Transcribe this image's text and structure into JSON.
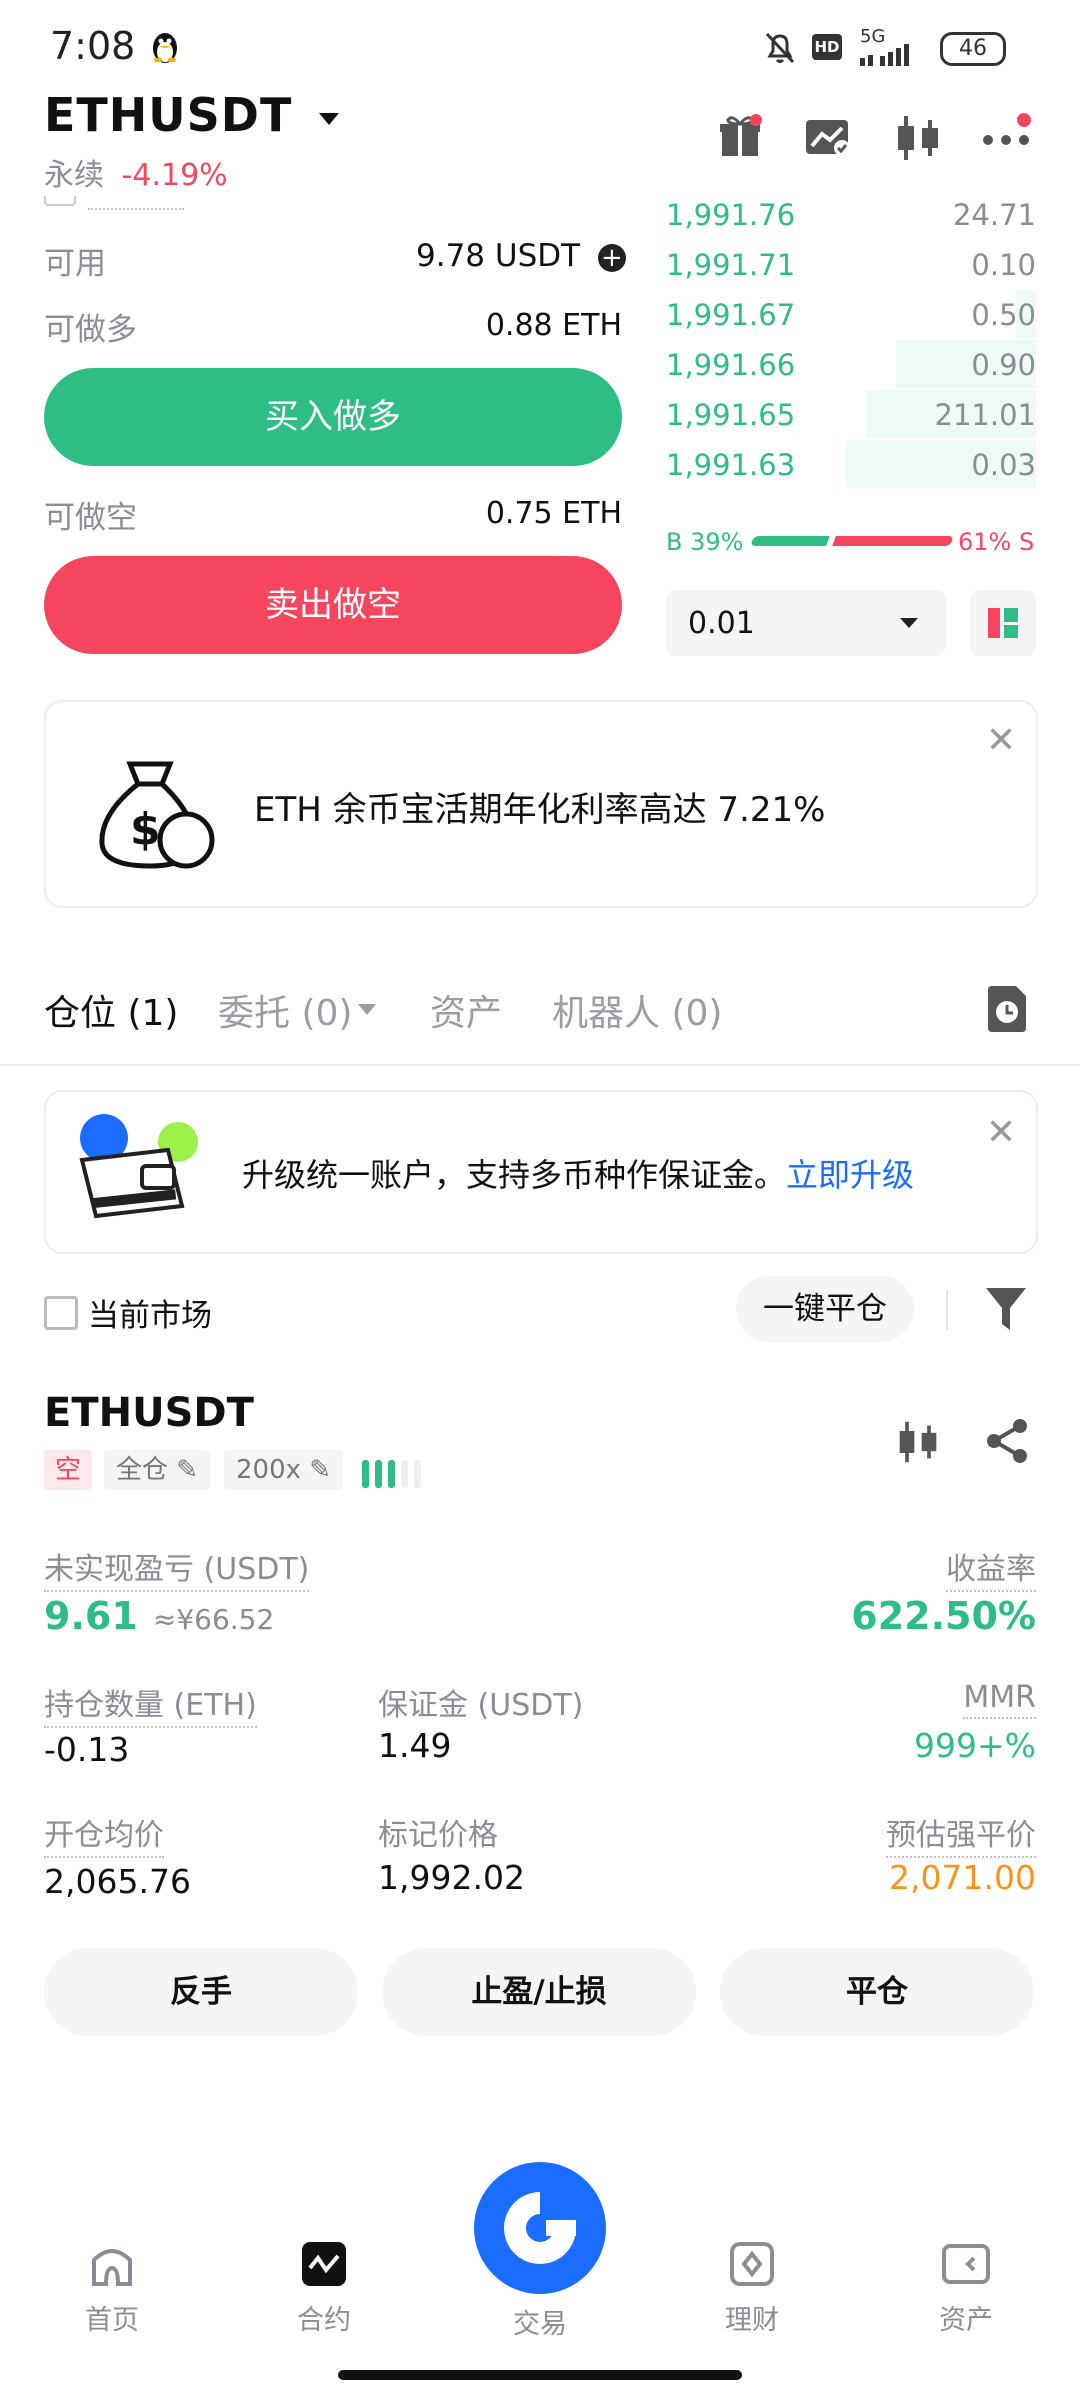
{
  "status": {
    "time": "7:08",
    "network": "5G",
    "battery": "46"
  },
  "header": {
    "pair": "ETHUSDT",
    "type": "永续",
    "change": "-4.19%"
  },
  "balance": {
    "available_label": "可用",
    "available_value": "9.78 USDT",
    "long_label": "可做多",
    "long_value": "0.88 ETH",
    "short_label": "可做空",
    "short_value": "0.75 ETH"
  },
  "buttons": {
    "long": "买入做多",
    "short": "卖出做空"
  },
  "orderbook": {
    "rows": [
      {
        "price": "1,991.76",
        "qty": "24.71"
      },
      {
        "price": "1,991.71",
        "qty": "0.10"
      },
      {
        "price": "1,991.67",
        "qty": "0.50"
      },
      {
        "price": "1,991.66",
        "qty": "0.90"
      },
      {
        "price": "1,991.65",
        "qty": "211.01"
      },
      {
        "price": "1,991.63",
        "qty": "0.03"
      }
    ],
    "buy_ratio_label": "B 39%",
    "sell_ratio_label": "61% S",
    "buy_ratio": 0.39,
    "precision": "0.01"
  },
  "promo": {
    "text": "ETH 余币宝活期年化利率高达 7.21%"
  },
  "tabs": [
    "仓位 (1)",
    "委托 (0)",
    "资产",
    "机器人 (0)"
  ],
  "upgrade": {
    "text": "升级统一账户，支持多币种作保证金。",
    "link": "立即升级"
  },
  "filter": {
    "current_market": "当前市场",
    "close_all": "一键平仓"
  },
  "position": {
    "symbol": "ETHUSDT",
    "side": "空",
    "margin_mode": "全仓",
    "leverage": "200x",
    "upnl_label": "未实现盈亏 (USDT)",
    "upnl": "9.61",
    "upnl_cny": "≈¥66.52",
    "roe_label": "收益率",
    "roe": "622.50%",
    "size_label": "持仓数量 (ETH)",
    "size": "-0.13",
    "margin_label": "保证金 (USDT)",
    "margin": "1.49",
    "mmr_label": "MMR",
    "mmr": "999+%",
    "entry_label": "开仓均价",
    "entry": "2,065.76",
    "mark_label": "标记价格",
    "mark": "1,992.02",
    "liq_label": "预估强平价",
    "liq": "2,071.00"
  },
  "actions": {
    "reverse": "反手",
    "tpsl": "止盈/止损",
    "close": "平仓"
  },
  "nav": [
    {
      "label": "首页",
      "icon": "home-icon"
    },
    {
      "label": "合约",
      "icon": "futures-icon"
    },
    {
      "label": "交易",
      "icon": "trade-icon"
    },
    {
      "label": "理财",
      "icon": "earn-icon"
    },
    {
      "label": "资产",
      "icon": "wallet-icon"
    }
  ],
  "colors": {
    "green": "#2ebd85",
    "red": "#f6465d",
    "blue": "#1a6dff",
    "orange": "#f7941d"
  }
}
